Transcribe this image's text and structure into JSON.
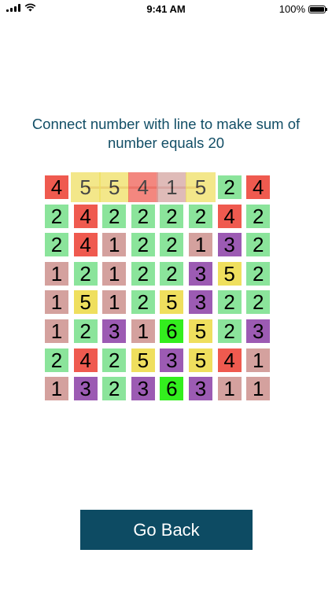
{
  "status_bar": {
    "time": "9:41 AM",
    "battery": "100%"
  },
  "instruction": "Connect number with line to make sum of number equals 20",
  "colors": {
    "1": "#d4a19e",
    "2": "#8be49b",
    "3": "#9c5bb3",
    "4": "#ef5a4f",
    "5": "#efdf5e",
    "6": "#33ee1e"
  },
  "grid": [
    [
      4,
      5,
      5,
      4,
      1,
      5,
      2,
      4
    ],
    [
      2,
      4,
      2,
      2,
      2,
      2,
      4,
      2
    ],
    [
      2,
      4,
      1,
      2,
      2,
      1,
      3,
      2
    ],
    [
      1,
      2,
      1,
      2,
      2,
      3,
      5,
      2
    ],
    [
      1,
      5,
      1,
      2,
      5,
      3,
      2,
      2
    ],
    [
      1,
      2,
      3,
      1,
      6,
      5,
      2,
      3
    ],
    [
      2,
      4,
      2,
      5,
      3,
      5,
      4,
      1
    ],
    [
      1,
      3,
      2,
      3,
      6,
      3,
      1,
      1
    ]
  ],
  "selected_path": [
    [
      0,
      1
    ],
    [
      0,
      2
    ],
    [
      0,
      3
    ],
    [
      0,
      4
    ],
    [
      0,
      5
    ]
  ],
  "back_button": {
    "label": "Go Back"
  }
}
